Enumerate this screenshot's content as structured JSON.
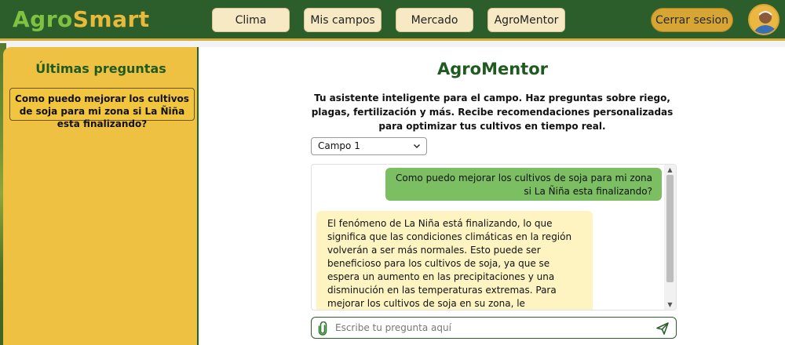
{
  "app": {
    "logo_part1": "Agro",
    "logo_part2": "Smart"
  },
  "nav": {
    "items": [
      {
        "label": "Clima"
      },
      {
        "label": "Mis campos"
      },
      {
        "label": "Mercado"
      },
      {
        "label": "AgroMentor"
      }
    ],
    "logout_label": "Cerrar sesion",
    "avatar_icon": "user-avatar"
  },
  "sidebar": {
    "title": "Últimas preguntas",
    "questions": [
      {
        "text": "Como puedo mejorar los cultivos de soja para mi zona si La Ñiña esta finalizando?"
      }
    ]
  },
  "main": {
    "title": "AgroMentor",
    "description": "Tu asistente inteligente para el campo. Haz preguntas sobre riego, plagas, fertilización y más. Recibe recomendaciones personalizadas para optimizar tus cultivos en tiempo real.",
    "field_select": {
      "selected": "Campo 1"
    },
    "chat": {
      "messages": [
        {
          "role": "user",
          "text": "Como puedo mejorar los cultivos de soja para mi zona si La Ñiña esta finalizando?"
        },
        {
          "role": "assistant",
          "text": "El fenómeno de La Niña está finalizando, lo que significa que las condiciones climáticas en la región volverán a ser más normales. Esto puede ser beneficioso para los cultivos de soja, ya que se espera un aumento en las precipitaciones y una disminución en las temperaturas extremas. Para mejorar los cultivos de soja en su zona, le recomiendo: * **Optimizar el manejo del agua:** El aumento de las precipitaciones puede"
        }
      ]
    },
    "input": {
      "placeholder": "Escribe tu pregunta aquí",
      "value": ""
    }
  },
  "colors": {
    "header_bg": "#2c5e2c",
    "logo_green": "#7fc242",
    "logo_gold": "#e8b93b",
    "sidebar_bg": "#efc142",
    "user_bubble": "#7cbf62",
    "bot_bubble": "#fdf4c2",
    "accent_gold": "#d6a534"
  }
}
